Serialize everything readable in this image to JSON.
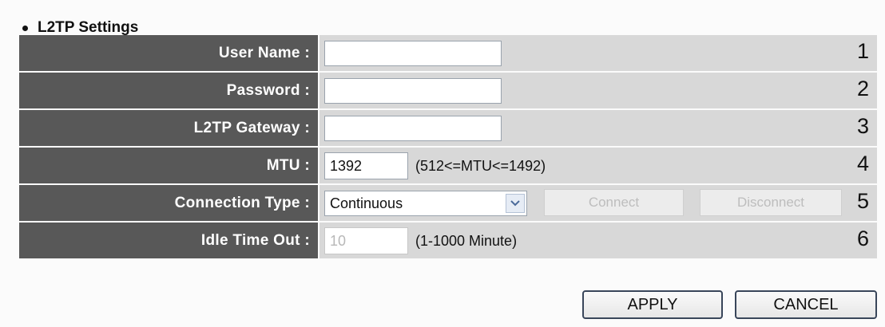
{
  "section": {
    "title": "L2TP Settings"
  },
  "rows": [
    {
      "label": "User Name :",
      "num": "1",
      "value": ""
    },
    {
      "label": "Password :",
      "num": "2",
      "value": ""
    },
    {
      "label": "L2TP Gateway :",
      "num": "3",
      "value": ""
    },
    {
      "label": "MTU :",
      "num": "4",
      "value": "1392",
      "hint": "(512<=MTU<=1492)"
    },
    {
      "label": "Connection Type :",
      "num": "5",
      "selected": "Continuous",
      "connect_label": "Connect",
      "disconnect_label": "Disconnect"
    },
    {
      "label": "Idle Time Out :",
      "num": "6",
      "value": "10",
      "hint": "(1-1000 Minute)"
    }
  ],
  "buttons": {
    "apply": "APPLY",
    "cancel": "CANCEL"
  },
  "icons": {
    "dropdown": "chevron-down-icon",
    "bullet": "bullet-icon"
  }
}
